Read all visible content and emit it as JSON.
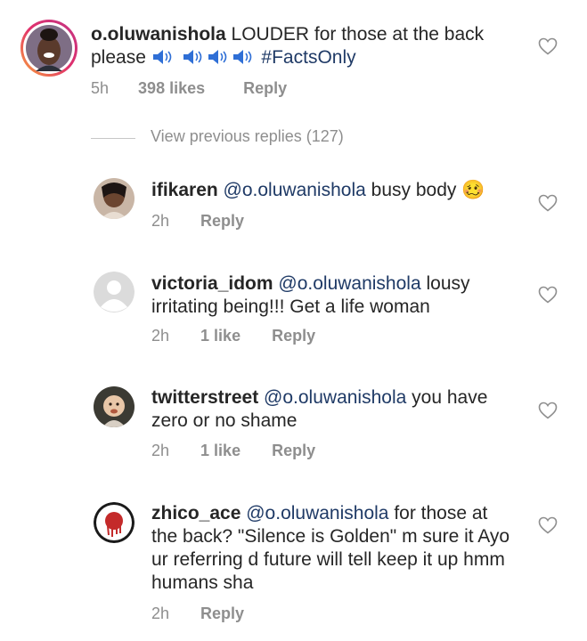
{
  "main_comment": {
    "username": "o.oluwanishola",
    "text": "LOUDER for those at the back please",
    "hashtag": "#FactsOnly",
    "time": "5h",
    "likes": "398 likes",
    "reply": "Reply"
  },
  "view_previous_replies": "View previous replies (127)",
  "replies": [
    {
      "username": "ifikaren",
      "mention": "@o.oluwanishola",
      "text": "busy body",
      "emoji": "🥴",
      "time": "2h",
      "likes": "",
      "reply": "Reply"
    },
    {
      "username": "victoria_idom",
      "mention": "@o.oluwanishola",
      "text": "lousy irritating being!!! Get a life woman",
      "time": "2h",
      "likes": "1 like",
      "reply": "Reply"
    },
    {
      "username": "twitterstreet",
      "mention": "@o.oluwanishola",
      "text": "you have zero or no shame",
      "time": "2h",
      "likes": "1 like",
      "reply": "Reply"
    },
    {
      "username": "zhico_ace",
      "mention": "@o.oluwanishola",
      "text": "for those at the back? \"Silence is Golden\" m sure it Ayo ur referring d future will tell keep it up hmm humans sha",
      "time": "2h",
      "likes": "",
      "reply": "Reply"
    }
  ],
  "icons": {
    "heart": "heart-outline-icon",
    "speaker": "speaker-loud-icon"
  },
  "colors": {
    "text": "#262626",
    "muted": "#8e8e8e",
    "mention": "#1f3a66",
    "story_ring": "#e1306c"
  }
}
